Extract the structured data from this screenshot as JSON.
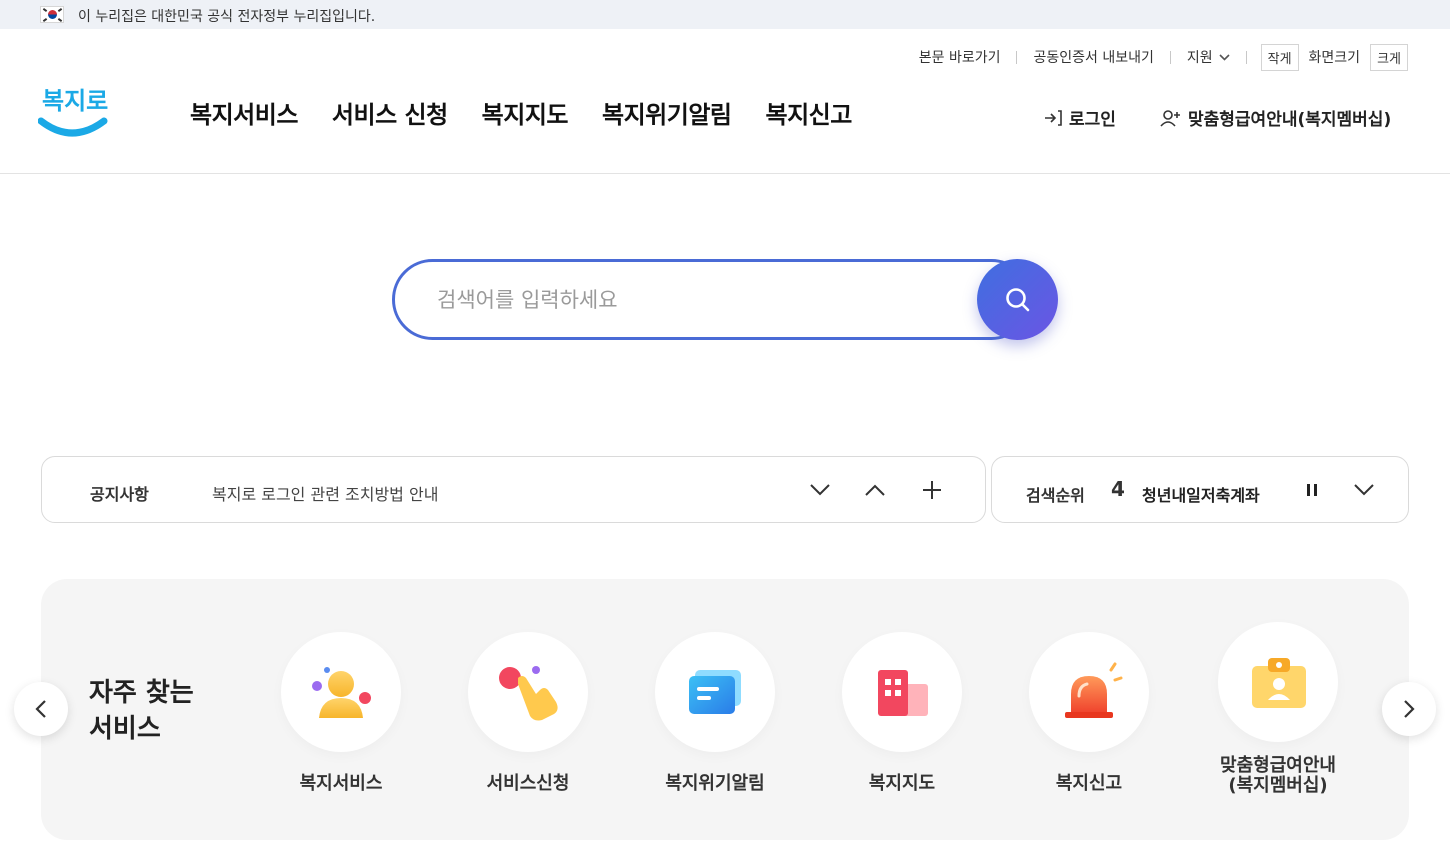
{
  "gov_banner": {
    "text": "이 누리집은 대한민국 공식 전자정부 누리집입니다."
  },
  "logo": {
    "text": "복지로"
  },
  "utility": {
    "skip": "본문 바로가기",
    "cert": "공동인증서 내보내기",
    "support": "지원",
    "small": "작게",
    "size": "화면크기",
    "large": "크게"
  },
  "gnb": [
    "복지서비스",
    "서비스 신청",
    "복지지도",
    "복지위기알림",
    "복지신고"
  ],
  "header_actions": {
    "login": "로그인",
    "member": "맞춤형급여안내(복지멤버십)"
  },
  "search": {
    "placeholder": "검색어를 입력하세요"
  },
  "notice": {
    "label": "공지사항",
    "text": "복지로 로그인 관련 조치방법 안내"
  },
  "ranking": {
    "label": "검색순위",
    "rank": "4",
    "keyword": "청년내일저축계좌"
  },
  "services": {
    "title_line1": "자주 찾는",
    "title_line2": "서비스",
    "items": [
      {
        "label": "복지서비스"
      },
      {
        "label": "서비스신청"
      },
      {
        "label": "복지위기알림"
      },
      {
        "label": "복지지도"
      },
      {
        "label": "복지신고"
      },
      {
        "label_line1": "맞춤형급여안내",
        "label_line2": "(복지멤버십)"
      }
    ]
  },
  "colors": {
    "accent": "#4a6bd6",
    "search_gradient_end": "#6b55e4",
    "logo_blue": "#1ba9e6"
  }
}
